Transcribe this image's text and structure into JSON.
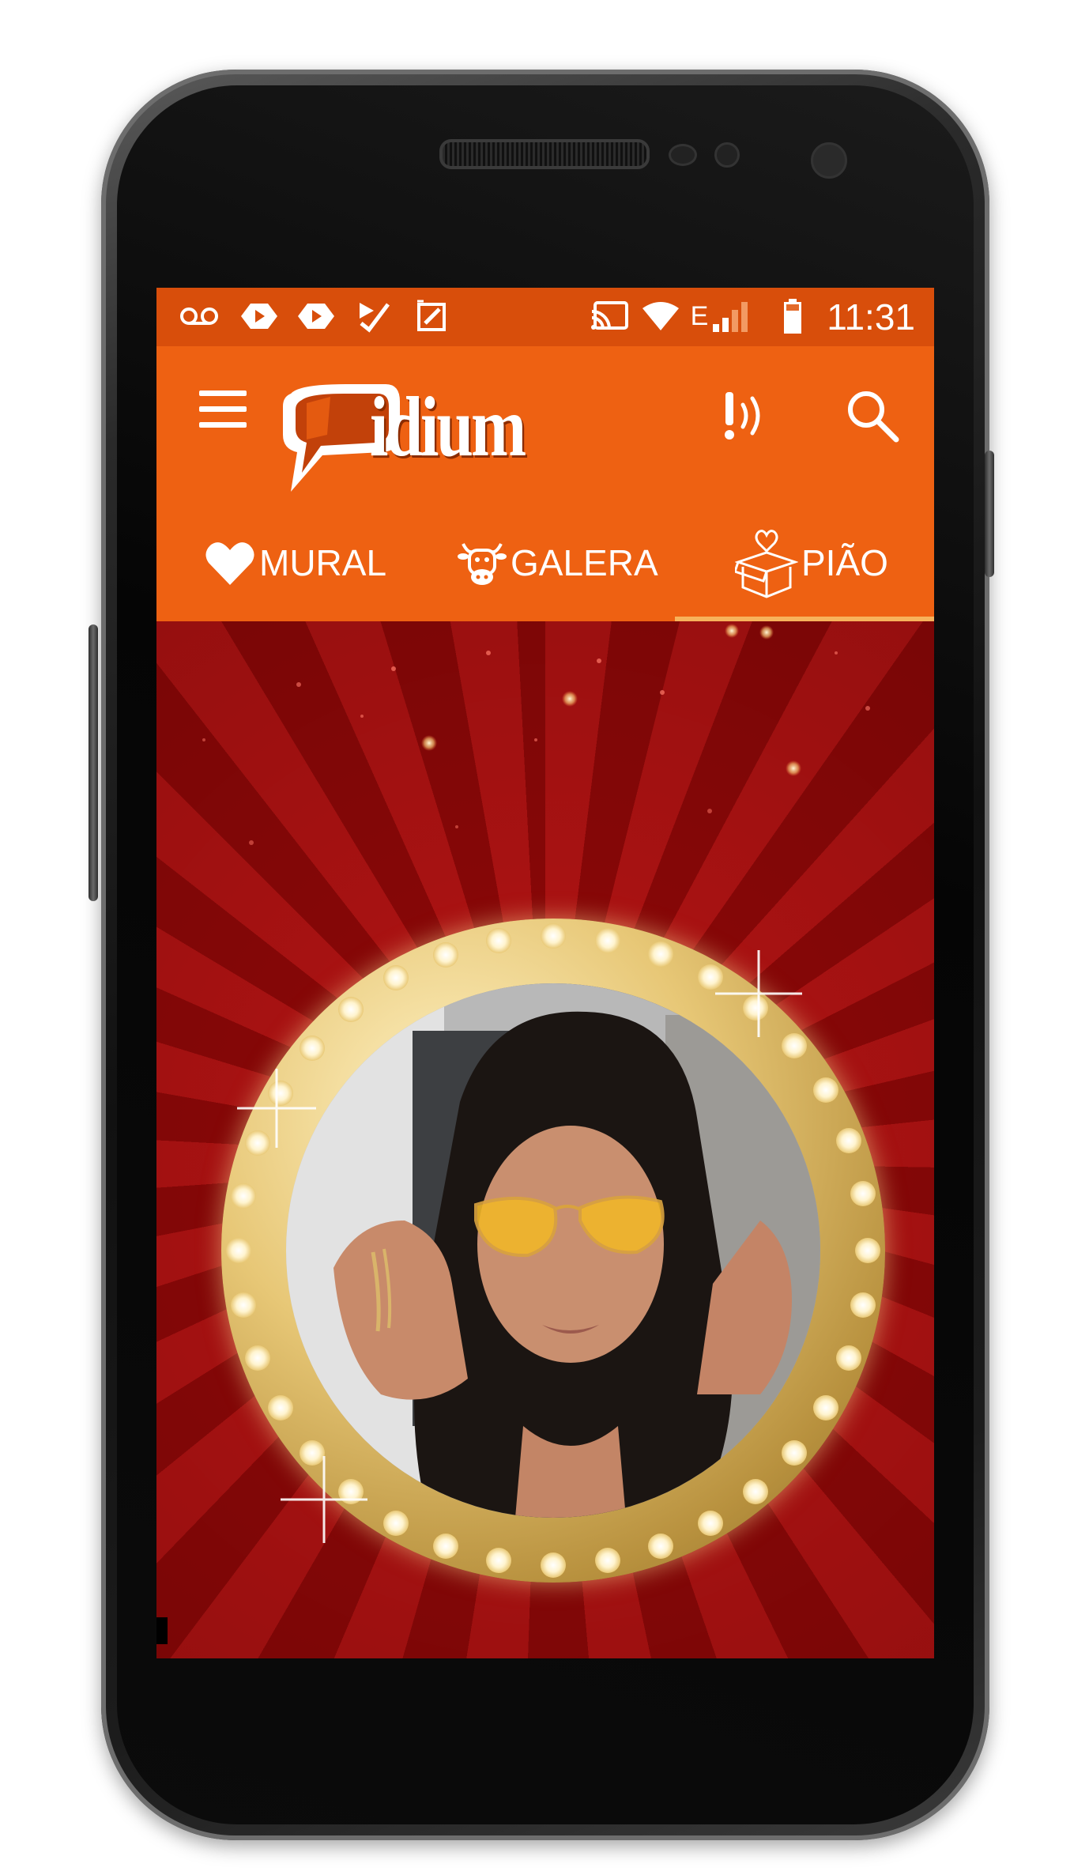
{
  "status_bar": {
    "time": "11:31",
    "network_label": "E",
    "left_icons": [
      "voicemail-icon",
      "youtube-icon",
      "youtube-icon",
      "check-app-icon",
      "image-edit-icon"
    ],
    "right_icons": [
      "cast-icon",
      "wifi-icon",
      "signal-icon",
      "battery-icon"
    ]
  },
  "app_bar": {
    "logo_text": "idium",
    "menu_icon": "hamburger-icon",
    "actions": [
      "alert-sound-icon",
      "search-icon"
    ]
  },
  "tabs": [
    {
      "label": "MURAL",
      "icon": "heart-icon",
      "selected": false
    },
    {
      "label": "GALERA",
      "icon": "cow-icon",
      "selected": false
    },
    {
      "label": "PIÃO",
      "icon": "gift-box-heart-icon",
      "selected": true
    }
  ],
  "colors": {
    "status_bar": "#d84e0b",
    "app_bar": "#ee6112",
    "tab_indicator": "#f7b25b",
    "background_red": "#9b0c0c",
    "frame_gold": "#e7c776"
  },
  "content": {
    "portrait": "woman-with-yellow-sunglasses"
  }
}
